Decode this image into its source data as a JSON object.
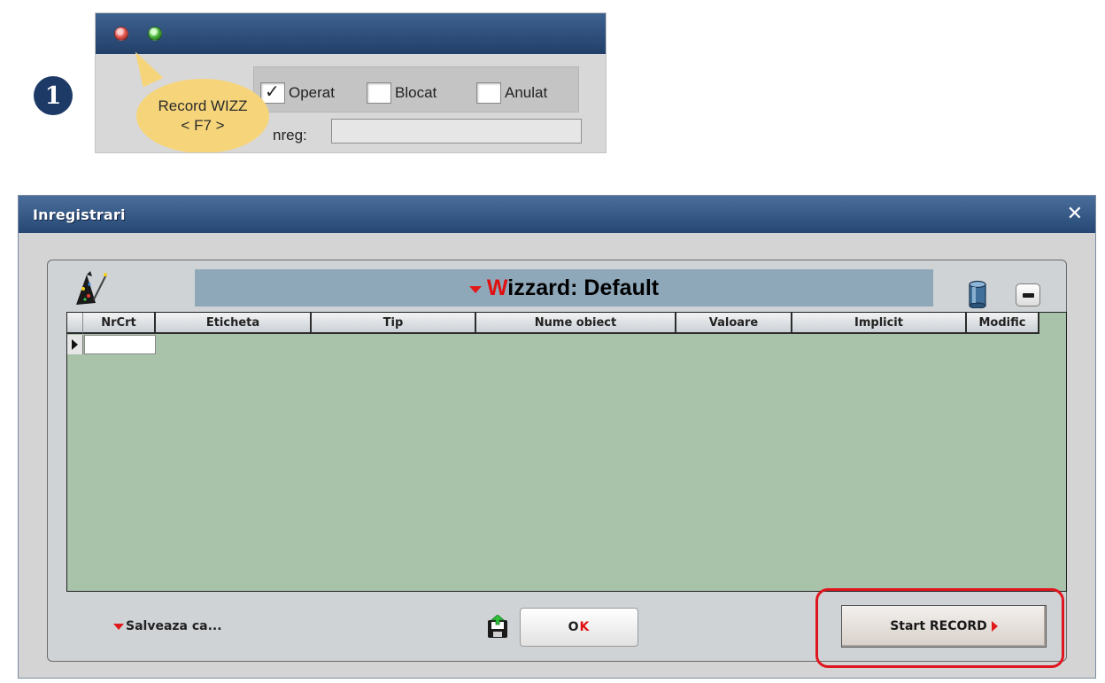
{
  "step_number": "1",
  "snippet": {
    "checkboxes": [
      {
        "label": "Operat",
        "checked": true
      },
      {
        "label": "Blocat",
        "checked": false
      },
      {
        "label": "Anulat",
        "checked": false
      }
    ],
    "enreg_label": "nreg:",
    "tooltip": {
      "line1": "Record WIZZ",
      "line2": "< F7 >"
    },
    "colors": {
      "titlebar": "#2c4a75",
      "tooltip": "#f6d57a"
    }
  },
  "window": {
    "title": "Inregistrari",
    "close_glyph": "✕",
    "wizard": {
      "prefix": "W",
      "title_rest": "izzard: Default"
    },
    "grid": {
      "columns": [
        "NrCrt",
        "Eticheta",
        "Tip",
        "Nume obiect",
        "Valoare",
        "Implicit",
        "Modific"
      ],
      "rows": []
    },
    "footer": {
      "save_as_label": "Salveaza ca...",
      "ok_prefix": "O",
      "ok_accent": "K",
      "start_record_label": "Start RECORD"
    },
    "colors": {
      "grid_bg": "#a9c3aa",
      "wizard_bar": "#8ea8ba",
      "accent_red": "#e01010",
      "highlight": "#e0161e"
    },
    "icons": [
      "wizard-hat-icon",
      "database-icon",
      "minus-icon",
      "save-disk-icon",
      "red-dropdown-caret-icon",
      "play-arrow-icon"
    ]
  }
}
